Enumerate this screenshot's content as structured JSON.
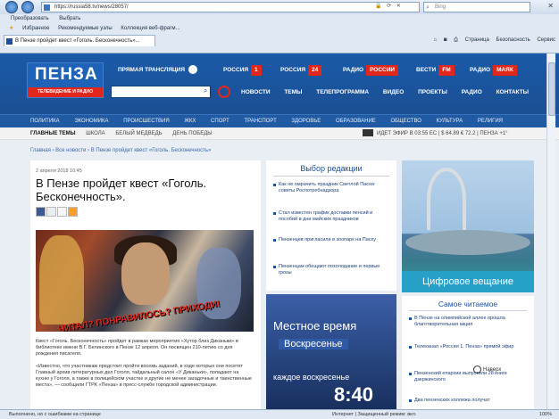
{
  "browser": {
    "address": "https://russia58.tv/news/28057/",
    "search_placeholder": "Bing",
    "menu": [
      "Преобразовать",
      "Выбрать"
    ],
    "favorites_label": "Избранное",
    "favorites_items": [
      "Рекомендуемые узлы",
      "Коллекция веб-фрагм..."
    ],
    "tab_title": "В Пензе пройдет квест «Гоголь. Бесконечность»...",
    "commands": [
      "Страница",
      "Безопасность",
      "Сервис"
    ],
    "status_left": "Выполнено, но с ошибками на странице",
    "status_mid": "Интернет | Защищенный режим: вкл.",
    "status_right": "100%"
  },
  "site": {
    "logo_title": "ПЕНЗА",
    "logo_subtitle": "ТЕЛЕВИДЕНИЕ И РАДИО",
    "live_label": "ПРЯМАЯ ТРАНСЛЯЦИЯ",
    "channels": [
      {
        "name": "РОССИЯ",
        "badge": "1"
      },
      {
        "name": "РОССИЯ",
        "badge": "24"
      },
      {
        "name": "РАДИО",
        "badge": "РОССИИ"
      },
      {
        "name": "ВЕСТИ",
        "badge": "FM"
      },
      {
        "name": "РАДИО",
        "badge": "МАЯК"
      }
    ],
    "sub_links": [
      "НОВОСТИ",
      "ТЕМЫ",
      "ТЕЛЕПРОГРАММА",
      "ВИДЕО",
      "ПРОЕКТЫ",
      "РАДИО",
      "КОНТАКТЫ"
    ],
    "categories": [
      "ПОЛИТИКА",
      "ЭКОНОМИКА",
      "ПРОИСШЕСТВИЯ",
      "ЖКХ",
      "СПОРТ",
      "ТРАНСПОРТ",
      "ЗДОРОВЬЕ",
      "ОБРАЗОВАНИЕ",
      "ОБЩЕСТВО",
      "КУЛЬТУРА",
      "РЕЛИГИЯ"
    ],
    "themes": [
      "ГЛАВНЫЕ ТЕМЫ",
      "ШКОЛА",
      "БЕЛЫЙ МЕДВЕДЬ",
      "ДЕНЬ ПОБЕДЫ"
    ],
    "ticker": "ИДЕТ ЭФИР В 03:55 ЕС   |   $ 64.89   € 72.2   |   ПЕНЗА  +1°"
  },
  "article": {
    "breadcrumb": "Главная › Все новости › В Пензе пройдет квест «Гоголь. Бесконечность»",
    "date": "2 апреля 2018 10:45",
    "headline": "В Пензе пройдет квест «Гоголь. Бесконечность».",
    "image_caption": "ЧИТАЛ? ПОНРАВИЛОСЬ? ПРИХОДИ!",
    "paragraphs": [
      "Квест «Гоголь. Бесконечность» пройдет в рамках мероприятия «Хутор близ Диканьки» в библиотеке имени В.Г. Белинского в Пензе 12 апреля. Он посвящен 210-летию со дня рождения писателя.",
      "«Известно, что участникам предстоит пройти восемь заданий, в ходе которых они посетят Главный архив литературных дел Гоголя, тайдальный салон «У Диканьки», попадают на кухню у Гоголя, а также в полицейском участке и другие не менее загадочные и таинственные места», — сообщили ГТРК «Пенза» в пресс-службе городской администрации."
    ]
  },
  "editors_choice": {
    "title": "Выбор редакции",
    "items": [
      "Как не омрачить праздник Светлой Пасхи: советы Роспотребнадзора",
      "Стал известен график доставки пенсий и пособий в дни майских праздников",
      "Пензенцев пригласили в зоопарк на Пасху",
      "Пензенцам обещают похолодание и первые грозы"
    ]
  },
  "promo": {
    "line1": "Местное время",
    "line2": "Воскресенье",
    "line3": "каждое воскресенье",
    "time": "8:40"
  },
  "ad": {
    "caption": "Цифровое вещание"
  },
  "popular": {
    "title": "Самое читаемое",
    "items": [
      "В Пензе на олимпийской аллее прошла благотворительная акция",
      "Телеканал «Россия 1. Пенза» прямой эфир",
      "Пензенский епархии выпустили 28 книге дзержинского",
      "Два пензенских коллежа получат"
    ],
    "next_label": "Наверх"
  }
}
